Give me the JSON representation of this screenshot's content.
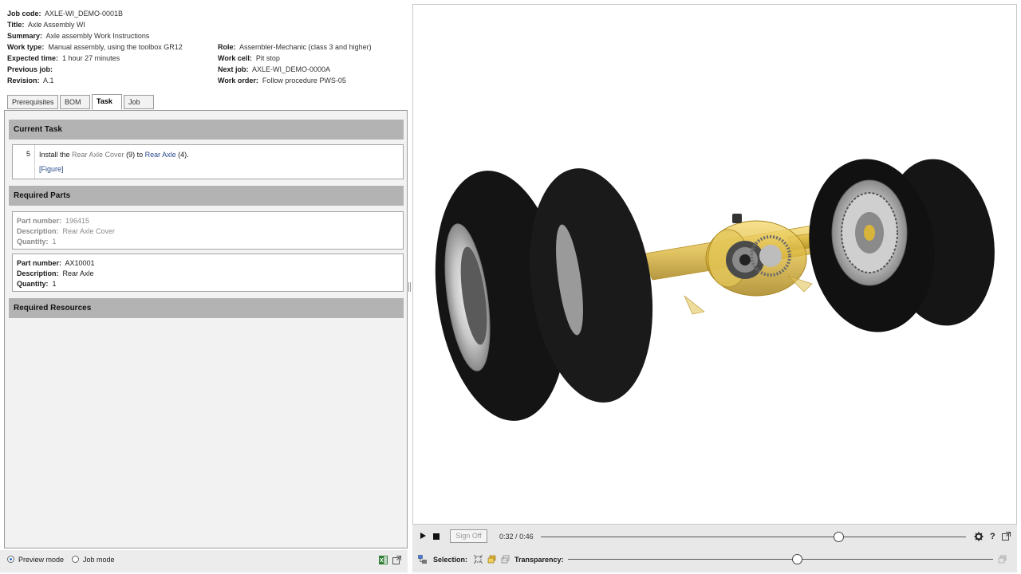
{
  "job_info": {
    "job_code_label": "Job code:",
    "job_code": "AXLE-WI_DEMO-0001B",
    "title_label": "Title:",
    "title": "Axle Assembly WI",
    "summary_label": "Summary:",
    "summary": "Axle assembly Work Instructions",
    "work_type_label": "Work type:",
    "work_type": "Manual assembly, using the toolbox GR12",
    "expected_time_label": "Expected time:",
    "expected_time": "1 hour 27 minutes",
    "previous_job_label": "Previous job:",
    "previous_job": "",
    "revision_label": "Revision:",
    "revision": "A.1",
    "role_label": "Role:",
    "role": "Assembler-Mechanic (class 3 and higher)",
    "work_cell_label": "Work cell:",
    "work_cell": "Pit stop",
    "next_job_label": "Next job:",
    "next_job": "AXLE-WI_DEMO-0000A",
    "work_order_label": "Work order:",
    "work_order": "Follow procedure PWS-05"
  },
  "tabs": [
    {
      "label": "Prerequisites",
      "active": false
    },
    {
      "label": "BOM",
      "active": false
    },
    {
      "label": "Task",
      "active": true
    },
    {
      "label": "Job",
      "active": false
    }
  ],
  "current_task": {
    "heading": "Current Task",
    "step_number": "5",
    "text_prefix": "Install the ",
    "part_a": "Rear Axle Cover",
    "part_a_ref": " (9) to ",
    "part_b": "Rear Axle",
    "part_b_ref": " (4).",
    "figure_link": "[Figure]"
  },
  "required_parts": {
    "heading": "Required Parts",
    "part_number_label": "Part number:",
    "description_label": "Description:",
    "quantity_label": "Quantity:",
    "items": [
      {
        "part_number": "196415",
        "description": "Rear Axle Cover",
        "quantity": "1"
      },
      {
        "part_number": "AX10001",
        "description": "Rear Axle",
        "quantity": "1"
      }
    ]
  },
  "required_resources": {
    "heading": "Required Resources"
  },
  "footer": {
    "preview_mode_label": "Preview mode",
    "job_mode_label": "Job mode",
    "selected_mode": "preview"
  },
  "player": {
    "sign_off_label": "Sign Off",
    "current_time": "0:32",
    "separator": "/",
    "total_time": "0:46",
    "progress_fraction": 0.7,
    "help_glyph": "?",
    "selection_label": "Selection:",
    "transparency_label": "Transparency:",
    "transparency_fraction": 0.54
  },
  "icons": [
    "play-icon",
    "stop-icon",
    "gear-icon",
    "help-icon",
    "fullscreen-icon",
    "excel-icon",
    "popout-icon",
    "model-tree-icon",
    "select-box-icon",
    "select-part-icon",
    "select-transparent-icon",
    "layers-icon"
  ],
  "colors": {
    "section_header": "#b3b3b3",
    "panel_bg": "#f2f2f2",
    "link_blue": "#2a4b8a",
    "axle_gold": "#d9b43a",
    "tire_black": "#141414"
  }
}
